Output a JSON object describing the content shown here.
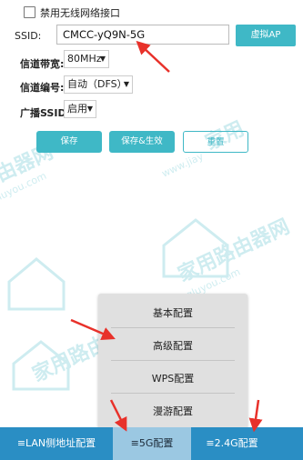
{
  "wireless": {
    "disable_label": "禁用无线网络接口",
    "ssid_label": "SSID:",
    "ssid_value": "CMCC-yQ9N-5G",
    "virtual_ap": "虚拟AP",
    "bandwidth_label": "信道带宽:",
    "bandwidth_value": "80MHz",
    "channel_label": "信道编号:",
    "channel_value": "自动（DFS）",
    "broadcast_label": "广播SSID",
    "broadcast_value": "启用"
  },
  "buttons": {
    "save": "保存",
    "save_apply": "保存&生效",
    "reset": "重置"
  },
  "menu": {
    "items": [
      "基本配置",
      "高级配置",
      "WPS配置",
      "漫游配置"
    ]
  },
  "tabs": {
    "lan": "≡LAN侧地址配置",
    "g5": "≡5G配置",
    "g24": "≡2.4G配置"
  },
  "watermark": {
    "text_cn": "家用路由器网",
    "text_en": "www.jiayongluyou.com"
  },
  "colors": {
    "accent": "#3fb8c6",
    "bottom_bar": "#2a8ec4",
    "active_tab": "#9bc8e2",
    "annotation": "#e8312a"
  },
  "icons": {
    "dropdown": "chevron-down-icon",
    "annotation": "red-arrow-icon"
  }
}
